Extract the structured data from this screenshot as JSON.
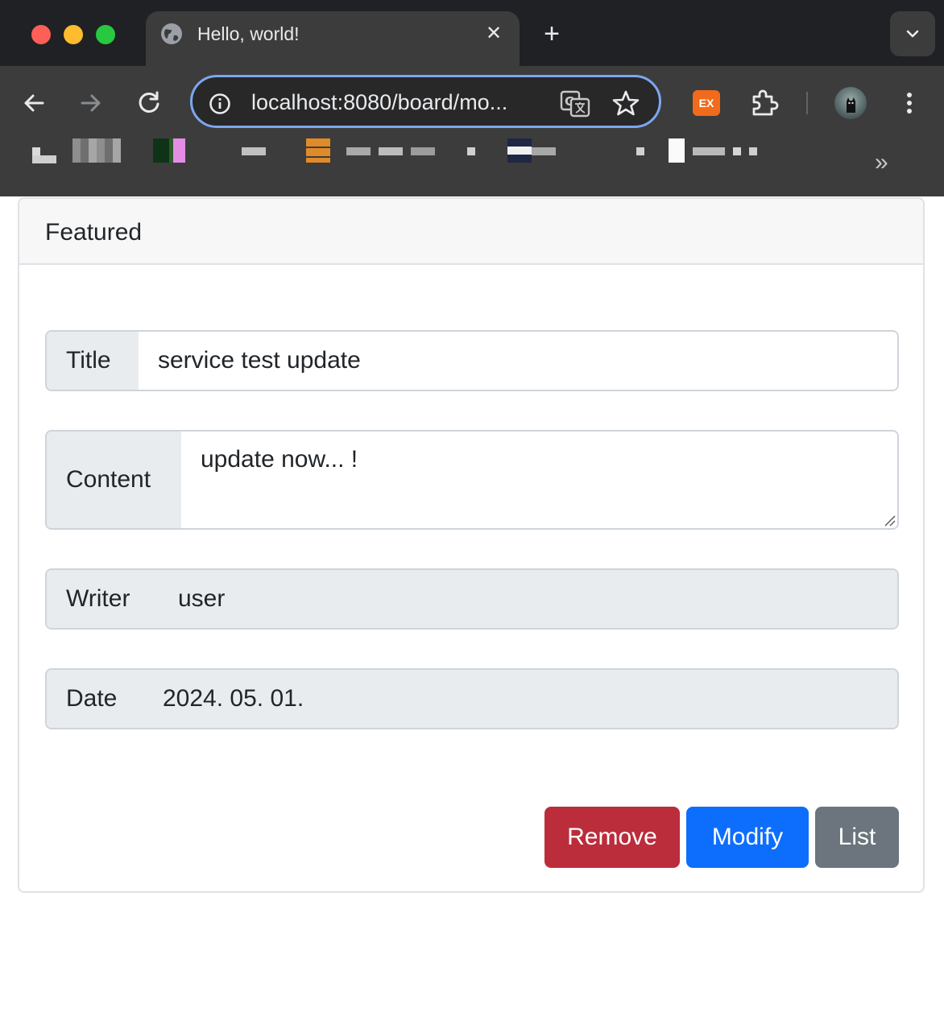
{
  "browser": {
    "tab_title": "Hello, world!",
    "tab_close_glyph": "✕",
    "new_tab_glyph": "+",
    "url": "localhost:8080/board/mo...",
    "extension_ex_label": "EX",
    "bookmarks_overflow_glyph": "»"
  },
  "card": {
    "header": "Featured",
    "fields": {
      "title_label": "Title",
      "title_value": "service test update",
      "content_label": "Content",
      "content_value": "update now... !",
      "writer_label": "Writer",
      "writer_value": "user",
      "date_label": "Date",
      "date_value": "2024. 05. 01."
    },
    "buttons": {
      "remove": "Remove",
      "modify": "Modify",
      "list": "List"
    }
  },
  "colors": {
    "remove": "#bb2d3b",
    "modify": "#0d6efd",
    "list": "#6c757d",
    "omnibox_focus": "#7ca7f0"
  },
  "icons": [
    "globe-icon",
    "close-icon",
    "plus-icon",
    "chevron-down-icon",
    "back-arrow-icon",
    "forward-arrow-icon",
    "reload-icon",
    "info-icon",
    "translate-icon",
    "star-icon",
    "puzzle-icon",
    "kebab-menu-icon",
    "resize-grip-icon"
  ]
}
